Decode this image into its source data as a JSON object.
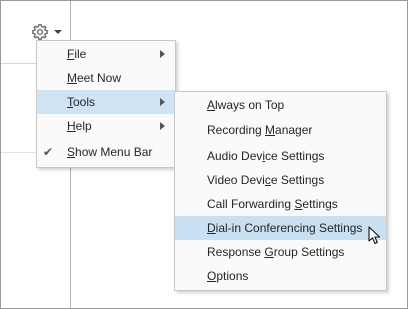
{
  "main_menu": {
    "items": [
      {
        "pre": "",
        "acc": "F",
        "post": "ile",
        "submenu": true
      },
      {
        "pre": "",
        "acc": "M",
        "post": "eet Now",
        "submenu": false
      },
      {
        "pre": "",
        "acc": "T",
        "post": "ools",
        "submenu": true
      },
      {
        "pre": "",
        "acc": "H",
        "post": "elp",
        "submenu": true
      },
      {
        "pre": "",
        "acc": "S",
        "post": "how Menu Bar",
        "checked_glyph": "✔"
      }
    ]
  },
  "tools_menu": {
    "items": [
      {
        "pre": "",
        "acc": "A",
        "post": "lways on Top"
      },
      {
        "pre": "Recording ",
        "acc": "M",
        "post": "anager"
      },
      {
        "pre": "Audio Dev",
        "acc": "i",
        "post": "ce Settings"
      },
      {
        "pre": "Video Devi",
        "acc": "c",
        "post": "e Settings"
      },
      {
        "pre": "Call Forwarding ",
        "acc": "S",
        "post": "ettings"
      },
      {
        "pre": "",
        "acc": "D",
        "post": "ial-in Conferencing Settings"
      },
      {
        "pre": "Response ",
        "acc": "G",
        "post": "roup Settings"
      },
      {
        "pre": "",
        "acc": "O",
        "post": "ptions"
      }
    ]
  },
  "icons": {
    "options_button": "gear-icon",
    "dropdown": "caret-down-icon",
    "pointer": "mouse-pointer-icon"
  },
  "colors": {
    "highlight": "#cfe3f5",
    "menu_background": "#fafafa",
    "border": "#c8c8c8"
  }
}
